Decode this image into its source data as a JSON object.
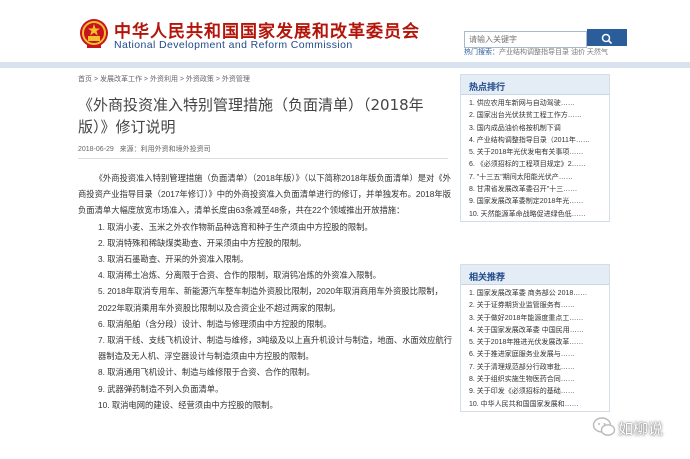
{
  "header": {
    "site_name_cn": "中华人民共和国国家发展和改革委员会",
    "site_name_en": "National Development and Reform Commission",
    "search_placeholder": "请输入关键字",
    "hot_label": "热门搜索：",
    "hot_words": "产业结构调整指导目录  油价  天然气"
  },
  "breadcrumb": "首页 > 发展改革工作 > 外资利用 > 外资政策 > 外资管理",
  "article": {
    "title": "《外商投资准入特别管理措施（负面清单）（2018年版）》修订说明",
    "date": "2018-06-29",
    "source": "来源：利用外资和境外投资司",
    "intro": "《外商投资准入特别管理措施（负面清单）（2018年版）》（以下简称2018年版负面清单）是对《外商投资产业指导目录（2017年修订）》中的外商投资准入负面清单进行的修订，并单独发布。2018年版负面清单大幅度放宽市场准入，清单长度由63条减至48条，共在22个领域推出开放措施：",
    "items": [
      "1. 取消小麦、玉米之外农作物新品种选育和种子生产须由中方控股的限制。",
      "2. 取消特殊和稀缺煤类勘查、开采须由中方控股的限制。",
      "3. 取消石墨勘查、开采的外资准入限制。",
      "4. 取消稀土冶炼、分离限于合资、合作的限制，取消钨冶炼的外资准入限制。",
      "5. 2018年取消专用车、新能源汽车整车制造外资股比限制，2020年取消商用车外资股比限制，2022年取消乘用车外资股比限制以及合资企业不超过两家的限制。",
      "6. 取消船舶（含分段）设计、制造与修理须由中方控股的限制。",
      "7. 取消干线、支线飞机设计、制造与维修，3吨级及以上直升机设计与制造，地面、水面效应航行器制造及无人机、浮空器设计与制造须由中方控股的限制。",
      "8. 取消通用飞机设计、制造与维修限于合资、合作的限制。",
      "9. 武器弹药制造不列入负面清单。",
      "10. 取消电网的建设、经营须由中方控股的限制。"
    ]
  },
  "hot_panel": {
    "title": "热点排行",
    "items": [
      "1. 供应农用车新网与自动驾驶……",
      "2. 国家出台光伏扶贫工程工作方……",
      "3. 国内成品油价格按机制下调",
      "4. 产业结构调整指导目录（2011年……",
      "5. 关于2018年光伏发电有关事项……",
      "6. 《必须招标的工程项目规定》2……",
      "7. \"十三五\"期间太阳能光伏产……",
      "8. 甘肃省发展改革委召开\"十三……",
      "9. 国家发展改革委制定2018年光……",
      "10. 天然能源革命战略促进绿色低……"
    ]
  },
  "related_panel": {
    "title": "相关推荐",
    "items": [
      "1. 国家发展改革委 商务部公 2018……",
      "2. 关于证券期货业监管服务有……",
      "3. 关于做好2018年能源度重点工……",
      "4. 关于国家发展改革委 中国民用……",
      "5. 关于2018年推进光伏发展改革……",
      "6. 关于推进家庭服务业发展与……",
      "7. 关于清理规范部分行政审批……",
      "8. 关于组织实施生物医药合同……",
      "9. 关于印发《必须招标的基础……",
      "10. 中华人民共和国国家发展和……"
    ]
  },
  "watermark": "如柳说",
  "colors": {
    "brand_red": "#b3150b",
    "brand_blue": "#1f4a8a",
    "panel_header": "#e4ecf5"
  }
}
